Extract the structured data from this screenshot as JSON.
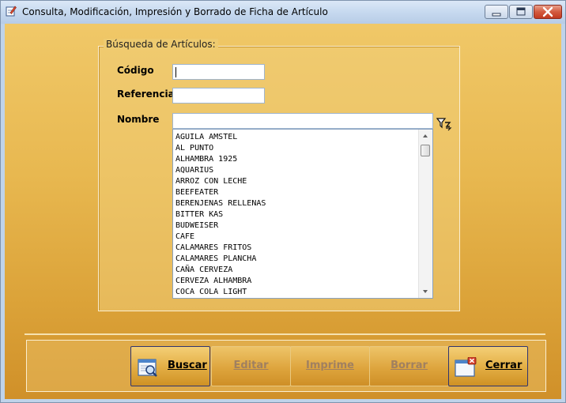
{
  "window": {
    "title": "Consulta, Modificación, Impresión y Borrado de Ficha de Artículo"
  },
  "search": {
    "group_label": "Búsqueda de Artículos:",
    "codigo_label": "Código",
    "referencia_label": "Referencia",
    "nombre_label": "Nombre",
    "codigo_value": "",
    "referencia_value": "",
    "nombre_value": ""
  },
  "articles": [
    "AGUILA AMSTEL",
    "AL PUNTO",
    "ALHAMBRA 1925",
    "AQUARIUS",
    "ARROZ CON LECHE",
    "BEEFEATER",
    "BERENJENAS RELLENAS",
    "BITTER KAS",
    "BUDWEISER",
    "CAFE",
    "CALAMARES FRITOS",
    "CALAMARES PLANCHA",
    "CAÑA CERVEZA",
    "CERVEZA ALHAMBRA",
    "COCA COLA LIGHT"
  ],
  "buttons": {
    "buscar": "Buscar",
    "editar": "Editar",
    "imprime": "Imprime",
    "borrar": "Borrar",
    "cerrar": "Cerrar"
  },
  "icons": {
    "app": "edit-document-icon",
    "filter": "filter-icon",
    "buscar": "search-document-icon",
    "cerrar": "close-window-icon"
  }
}
